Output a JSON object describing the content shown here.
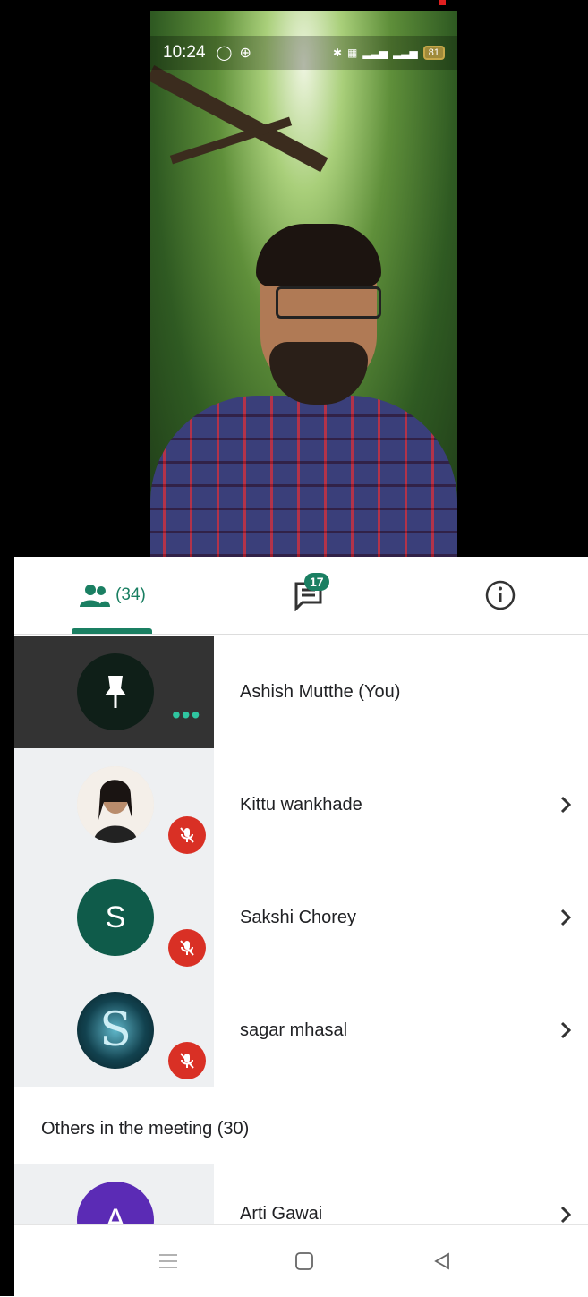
{
  "status_bar": {
    "time": "10:24",
    "battery": "81"
  },
  "tabs": {
    "people_count": "(34)",
    "chat_badge": "17"
  },
  "participants": [
    {
      "name": "Ashish Mutthe (You)",
      "avatar_type": "pin-icon",
      "muted": false
    },
    {
      "name": "Kittu wankhade",
      "avatar_type": "photo",
      "muted": true
    },
    {
      "name": "Sakshi Chorey",
      "avatar_letter": "S",
      "avatar_color": "#0f5b4a",
      "muted": true
    },
    {
      "name": "sagar mhasal",
      "avatar_letter": "S",
      "avatar_color": "#0b2a34",
      "muted": true
    }
  ],
  "others": {
    "title": "Others in the meeting (30)",
    "first": {
      "name": "Arti Gawai",
      "avatar_letter": "A",
      "avatar_color": "#5b2bb5"
    }
  },
  "colors": {
    "accent": "#1a7f62",
    "mute_red": "#d93025"
  }
}
